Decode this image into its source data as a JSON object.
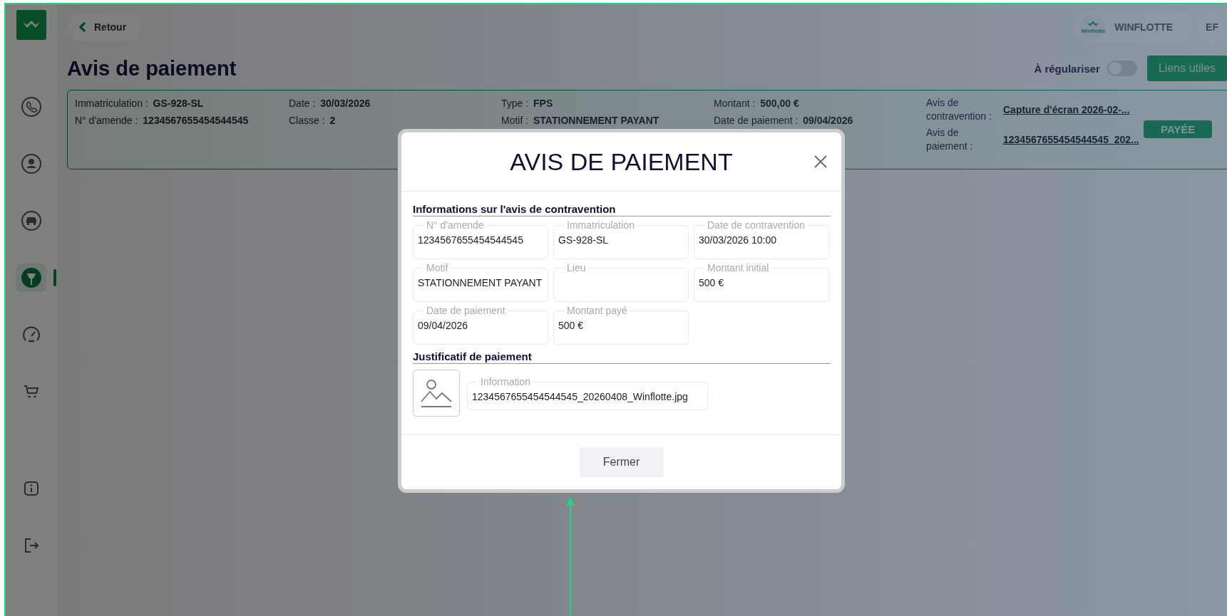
{
  "header": {
    "back_button": "Retour",
    "company": {
      "name": "WINFLOTTE",
      "logo_text": "Winflotte"
    },
    "avatar": "EF"
  },
  "sidebar": {
    "items": [
      {
        "kind": "phone",
        "selected": false
      },
      {
        "kind": "user",
        "selected": false
      },
      {
        "kind": "car",
        "selected": false
      },
      {
        "kind": "parking",
        "selected": true
      },
      {
        "kind": "gauge",
        "selected": false
      },
      {
        "kind": "cart",
        "selected": false
      }
    ],
    "bottom_items": [
      {
        "kind": "info",
        "selected": false
      },
      {
        "kind": "logout",
        "selected": false
      }
    ]
  },
  "page": {
    "title": "Avis de paiement",
    "toggle": {
      "label": "À régulariser",
      "on": false
    },
    "links_button": "Liens utiles"
  },
  "card": {
    "columns": [
      [
        {
          "label": "Immatriculation :",
          "value": "GS-928-SL"
        },
        {
          "label": "N° d'amende :",
          "value": "1234567655454544545"
        }
      ],
      [
        {
          "label": "Date :",
          "value": "30/03/2026"
        },
        {
          "label": "Classe :",
          "value": "2"
        }
      ],
      [
        {
          "label": "Type :",
          "value": "FPS"
        },
        {
          "label": "Motif :",
          "value": "STATIONNEMENT PAYANT"
        }
      ],
      [
        {
          "label": "Montant :",
          "value": "500,00 €"
        },
        {
          "label": "Date de paiement :",
          "value": "09/04/2026"
        }
      ]
    ],
    "documents": [
      {
        "label": "Avis de contravention :",
        "link": "Capture d'écran 2026-02-..."
      },
      {
        "label": "Avis de paiement :",
        "link": "1234567655454544545_202..."
      }
    ],
    "status": "PAYÉE"
  },
  "modal": {
    "title": "AVIS DE PAIEMENT",
    "sections": [
      {
        "title": "Informations sur l'avis de contravention",
        "fields": [
          {
            "label": "N° d'amende",
            "value": "1234567655454544545"
          },
          {
            "label": "Immatriculation",
            "value": "GS-928-SL"
          },
          {
            "label": "Date de contravention",
            "value": "30/03/2026 10:00"
          },
          {
            "label": "Motif",
            "value": "STATIONNEMENT PAYANT"
          },
          {
            "label": "Lieu"
          },
          {
            "label": "Montant initial",
            "value": "500 €"
          },
          {
            "label": "Date de paiement",
            "value": "09/04/2026"
          },
          {
            "label": "Montant payé",
            "value": "500 €"
          }
        ]
      },
      {
        "title": "Justificatif de paiement",
        "attachment": {
          "label": "Information",
          "value": "1234567655454544545_20260408_Winflotte.jpg"
        }
      }
    ],
    "close_button": "Fermer"
  }
}
